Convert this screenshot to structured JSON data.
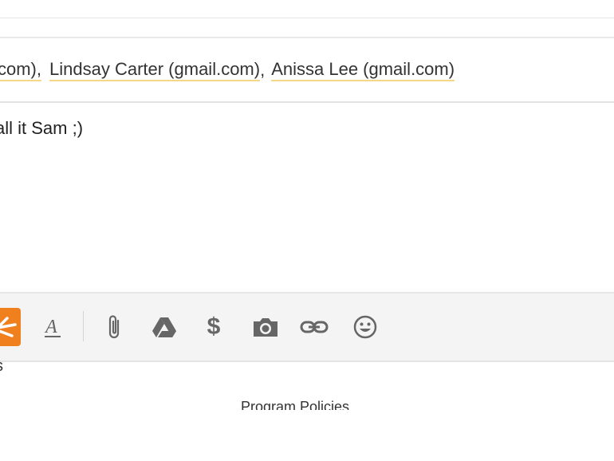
{
  "recipients": {
    "lead_fragment": "l.com),",
    "items": [
      {
        "name": "Lindsay Carter (gmail.com)",
        "separator": ","
      },
      {
        "name": "Anissa Lee (gmail.com)",
        "separator": ""
      }
    ]
  },
  "message": {
    "body": "all it Sam ;)"
  },
  "toolbar": {
    "accent_color": "#f07f1d",
    "icons": [
      "send-icon",
      "format-text-icon",
      "attach-icon",
      "drive-icon",
      "dollar-icon",
      "camera-icon",
      "link-icon",
      "emoji-icon"
    ],
    "dollar_glyph": "$"
  },
  "footer": {
    "stray_char": "s",
    "program_policies": "Program Policies"
  }
}
